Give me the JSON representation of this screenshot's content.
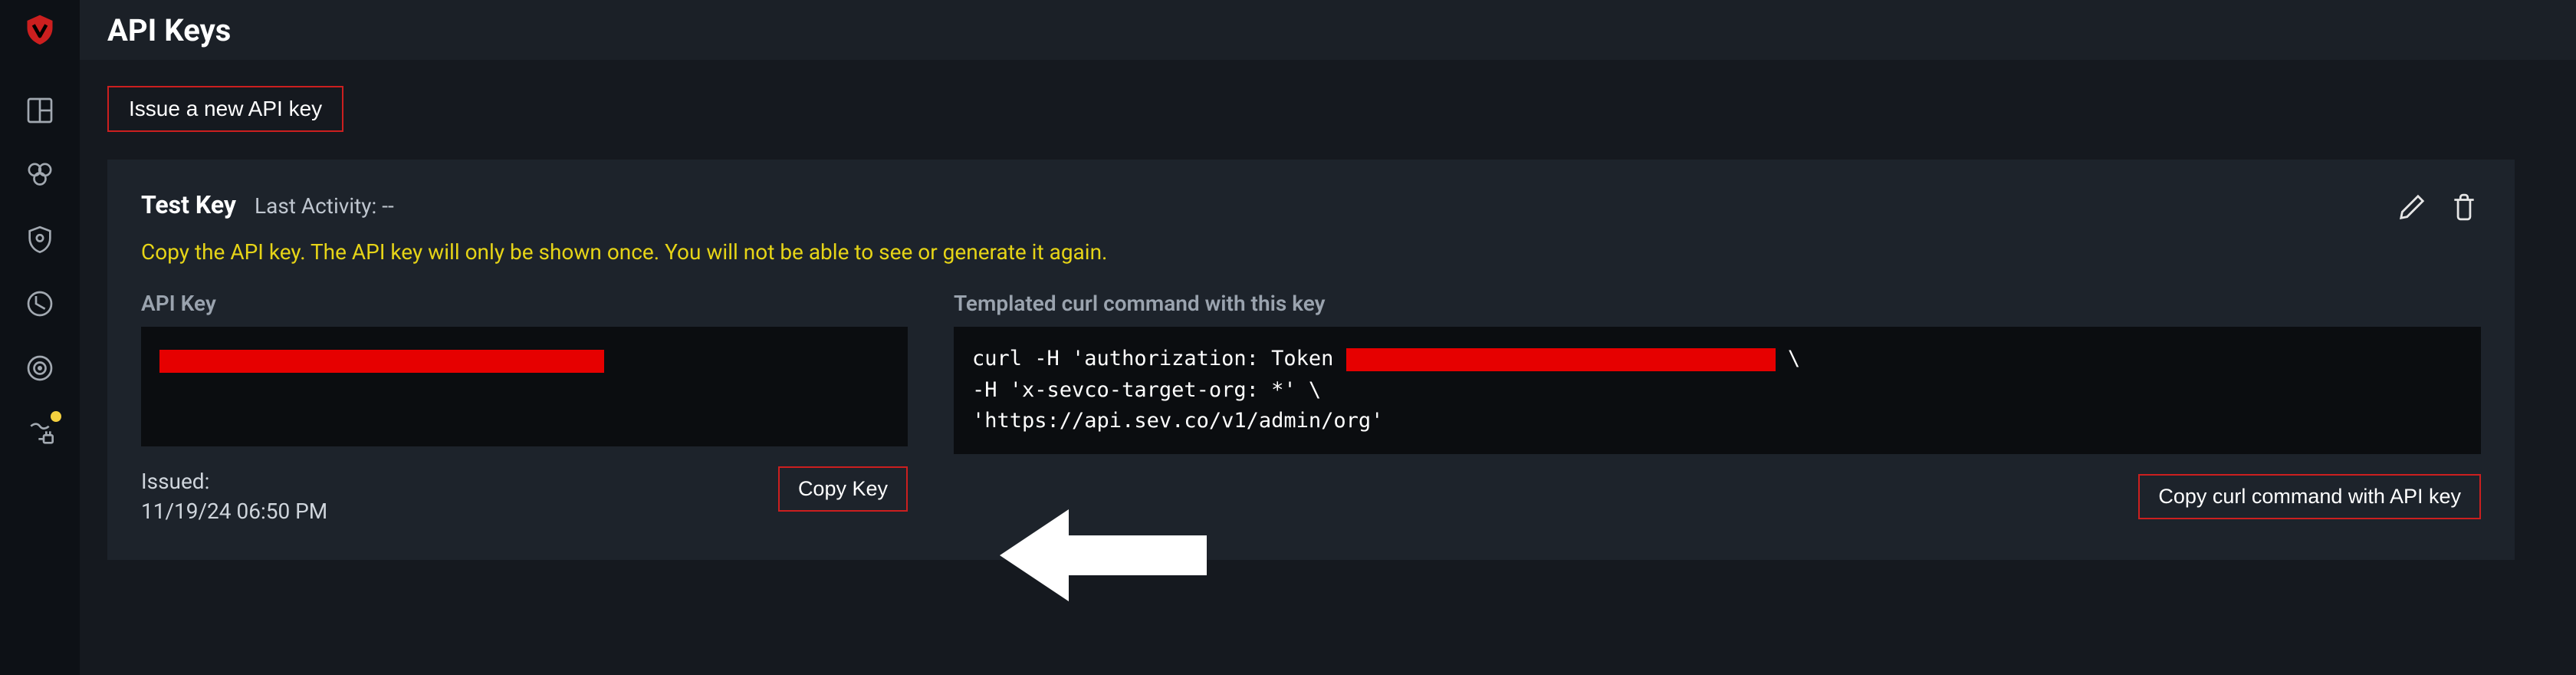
{
  "page": {
    "title": "API Keys"
  },
  "actions": {
    "issue_new_key": "Issue a new API key"
  },
  "key_card": {
    "name": "Test Key",
    "last_activity_label": "Last Activity: --",
    "warning": "Copy the API key. The API key will only be shown once. You will not be able to see or generate it again.",
    "api_key_label": "API Key",
    "api_key_value_redacted": true,
    "curl_label": "Templated curl command with this key",
    "curl_line_1_prefix": "curl -H 'authorization: Token",
    "curl_line_1_suffix": " \\",
    "curl_line_2": "-H 'x-sevco-target-org: *' \\",
    "curl_line_3": "'https://api.sev.co/v1/admin/org'",
    "issued_label": "Issued:",
    "issued_value": "11/19/24 06:50 PM",
    "copy_key_label": "Copy Key",
    "copy_curl_label": "Copy curl command with API key"
  },
  "sidebar": {
    "items": [
      {
        "name": "logo"
      },
      {
        "name": "dashboard"
      },
      {
        "name": "inventory"
      },
      {
        "name": "security"
      },
      {
        "name": "activity"
      },
      {
        "name": "targets"
      },
      {
        "name": "integrations",
        "badge": true
      }
    ]
  },
  "colors": {
    "accent_red": "#cc1f1f",
    "warning_yellow": "#e6d417",
    "badge_yellow": "#f4d03f"
  }
}
